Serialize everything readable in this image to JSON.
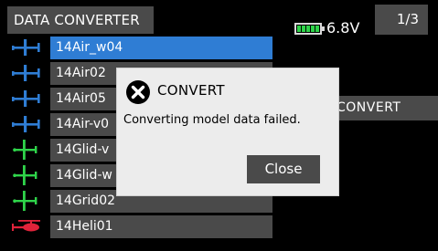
{
  "header": {
    "title": "DATA CONVERTER",
    "battery_voltage": "6.8V",
    "battery_level": 1.0,
    "page_indicator": "1/3"
  },
  "models": [
    {
      "label": "14Air_w04",
      "type": "airplane-icon",
      "selected": true
    },
    {
      "label": "14Air02",
      "type": "airplane-icon",
      "selected": false
    },
    {
      "label": "14Air05",
      "type": "airplane-icon",
      "selected": false
    },
    {
      "label": "14Air-v0",
      "type": "airplane-icon",
      "selected": false
    },
    {
      "label": "14Glid-v",
      "type": "glider-icon",
      "selected": false
    },
    {
      "label": "14Glid-w",
      "type": "glider-icon",
      "selected": false
    },
    {
      "label": "14Grid02",
      "type": "glider-icon",
      "selected": false
    },
    {
      "label": "14Heli01",
      "type": "helicopter-icon",
      "selected": false
    }
  ],
  "actions": {
    "convert_label": "CONVERT"
  },
  "dialog": {
    "title": "CONVERT",
    "message": "Converting model data failed.",
    "close_label": "Close",
    "icon": "error-x-icon"
  },
  "colors": {
    "background": "#000000",
    "tab_gray": "#4a4a4a",
    "selected_blue": "#2f7dd4",
    "airplane_blue": "#2f7dd4",
    "glider_green": "#2fd44a",
    "helicopter_red": "#e0233a",
    "dialog_bg": "#ececec",
    "battery_green": "#2fd44a"
  }
}
